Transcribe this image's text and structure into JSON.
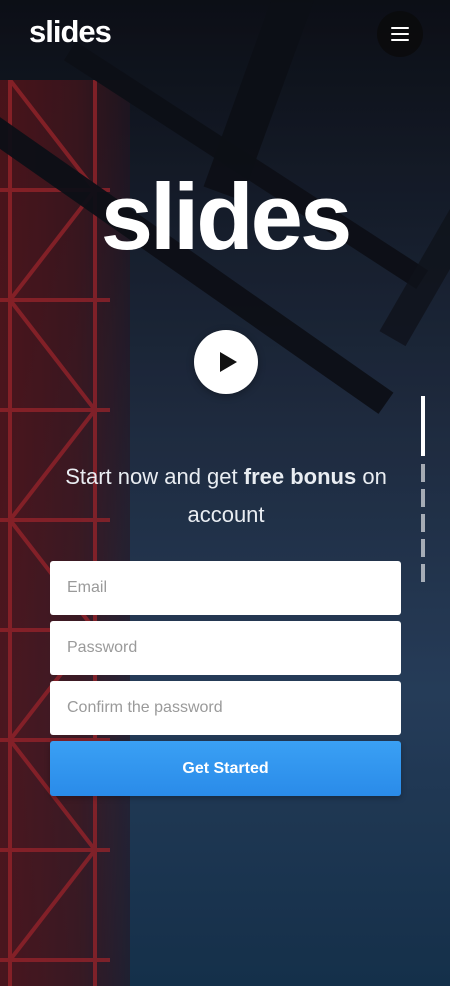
{
  "header": {
    "logo": "slides",
    "menu_icon": "hamburger-menu-icon"
  },
  "hero": {
    "logo": "slides",
    "play_icon": "play-icon",
    "tagline_before": "Start now and get ",
    "tagline_bold": "free bonus",
    "tagline_after": " on account"
  },
  "pager": {
    "count": 6,
    "active_index": 0
  },
  "form": {
    "email_placeholder": "Email",
    "password_placeholder": "Password",
    "confirm_placeholder": "Confirm the password",
    "submit_label": "Get Started"
  },
  "colors": {
    "accent": "#2f95ee",
    "tower": "#8b1a1e",
    "sky": "#294260"
  }
}
